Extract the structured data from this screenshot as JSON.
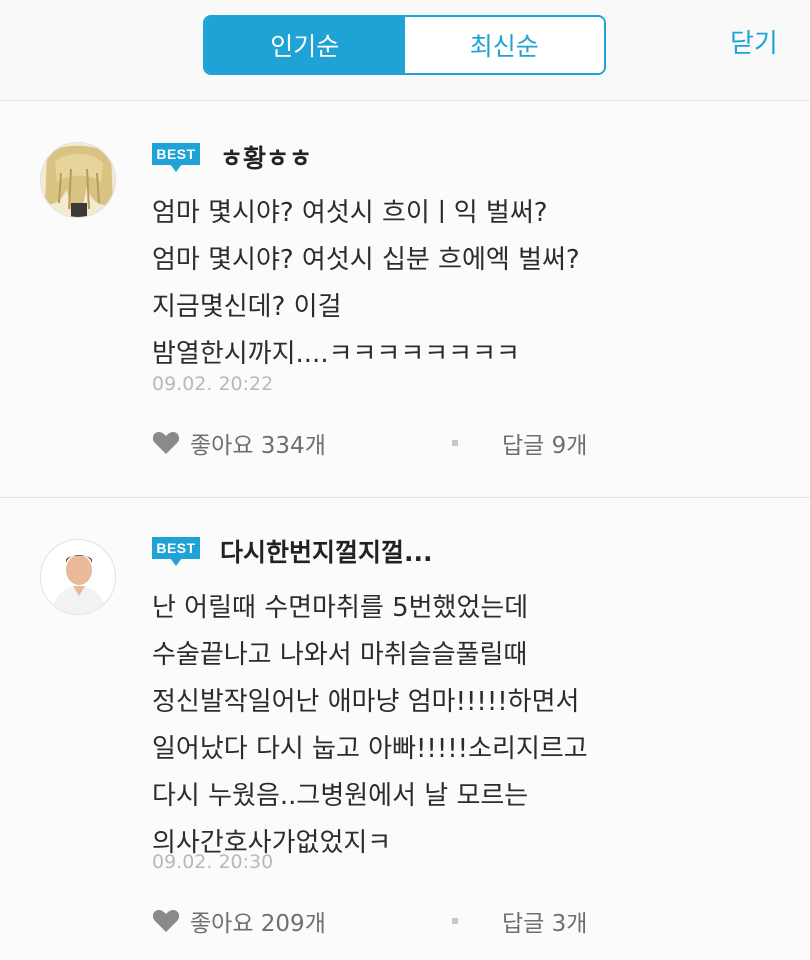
{
  "header": {
    "tabs": [
      {
        "label": "인기순",
        "active": true
      },
      {
        "label": "최신순",
        "active": false
      }
    ],
    "close_label": "닫기"
  },
  "comments": [
    {
      "badge": "BEST",
      "nickname": "ㅎ황ㅎㅎ",
      "lines": [
        "엄마 몇시야? 여섯시 흐이ㅣ익 벌써?",
        "엄마 몇시야? 여섯시 십분 흐에엑 벌써?",
        "지금몇신데? 이걸",
        "밤열한시까지....ㅋㅋㅋㅋㅋㅋㅋㅋ"
      ],
      "timestamp": "09.02. 20:22",
      "likes_label": "좋아요 334개",
      "replies_label": "답글 9개"
    },
    {
      "badge": "BEST",
      "nickname": "다시한번지껄지껄...",
      "lines": [
        "난 어릴때 수면마취를 5번했었는데",
        "수술끝나고 나와서 마취슬슬풀릴때",
        "정신발작일어난 애마냥 엄마!!!!!하면서",
        "일어났다 다시 눕고 아빠!!!!!소리지르고",
        "다시 누웠음..그병원에서 날 모르는",
        "의사간호사가없었지ㅋ"
      ],
      "timestamp": "09.02. 20:30",
      "likes_label": "좋아요 209개",
      "replies_label": "답글 3개"
    }
  ],
  "icons": {
    "heart": "heart-icon",
    "avatar_1": "anime-character-avatar",
    "avatar_2": "person-avatar"
  },
  "colors": {
    "accent": "#1fa3d6",
    "text": "#2c2c2c",
    "muted": "#6f6f6f",
    "timestamp": "#b9b9b9"
  }
}
